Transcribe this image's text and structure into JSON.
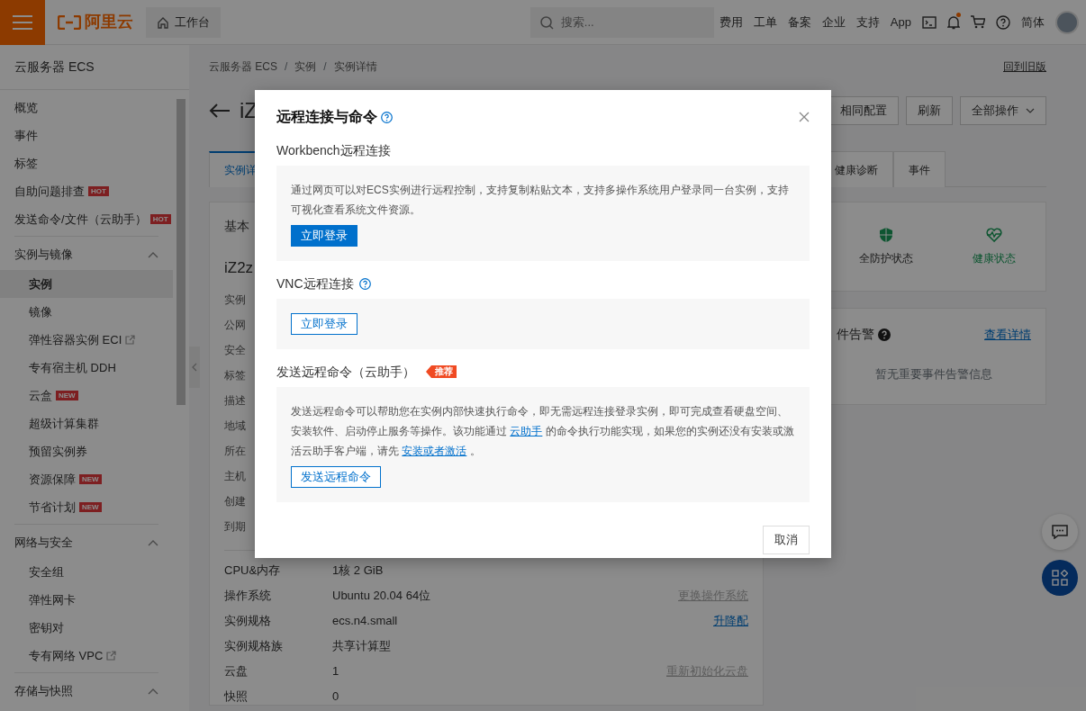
{
  "topbar": {
    "logo": "阿里云",
    "workbench": "工作台",
    "search": {
      "placeholder": "搜索..."
    },
    "links": [
      "费用",
      "工单",
      "备案",
      "企业",
      "支持",
      "App"
    ],
    "notification_dot": true,
    "language": "简体"
  },
  "sidebar": {
    "title": "云服务器 ECS",
    "items": [
      {
        "label": "概览",
        "selected": false
      },
      {
        "label": "事件",
        "selected": false
      },
      {
        "label": "标签",
        "selected": false
      },
      {
        "label": "自助问题排查",
        "badge": "HOT",
        "selected": false
      },
      {
        "label": "发送命令/文件（云助手）",
        "badge": "HOT",
        "selected": false
      }
    ],
    "groups": [
      {
        "label": "实例与镜像",
        "expanded": true,
        "items": [
          {
            "label": "实例",
            "selected": true,
            "external": false
          },
          {
            "label": "镜像",
            "selected": false,
            "external": false
          },
          {
            "label": "弹性容器实例 ECI",
            "selected": false,
            "external": true
          },
          {
            "label": "专有宿主机 DDH",
            "selected": false,
            "external": false
          },
          {
            "label": "云盒",
            "badge": "NEW",
            "selected": false,
            "external": false
          },
          {
            "label": "超级计算集群",
            "selected": false,
            "external": false
          },
          {
            "label": "预留实例券",
            "selected": false,
            "external": false
          },
          {
            "label": "资源保障",
            "badge": "NEW",
            "selected": false,
            "external": false
          },
          {
            "label": "节省计划",
            "badge": "NEW",
            "selected": false,
            "external": false
          }
        ]
      },
      {
        "label": "网络与安全",
        "expanded": true,
        "items": [
          {
            "label": "安全组",
            "selected": false,
            "external": false
          },
          {
            "label": "弹性网卡",
            "selected": false,
            "external": false
          },
          {
            "label": "密钥对",
            "selected": false,
            "external": false
          },
          {
            "label": "专有网络 VPC",
            "selected": false,
            "external": true
          }
        ]
      },
      {
        "label": "存储与快照",
        "expanded": true
      }
    ]
  },
  "main": {
    "breadcrumb": [
      "云服务器 ECS",
      "/",
      "实例",
      "/",
      "实例详情"
    ],
    "old_version": "回到旧版",
    "title": "iZ",
    "actions": [
      {
        "label": "相同配置",
        "dropdown": false
      },
      {
        "label": "刷新",
        "dropdown": false
      },
      {
        "label": "全部操作",
        "dropdown": true
      }
    ],
    "tabs": [
      {
        "label": "实例详",
        "selected": true
      },
      {
        "label": "健康诊断",
        "selected": false
      },
      {
        "label": "事件",
        "selected": false
      }
    ],
    "basic_info": {
      "heading": "基本",
      "name": "iZ2z",
      "labels": [
        "实例",
        "公网",
        "安全",
        "标签",
        "描述",
        "地域",
        "所在",
        "主机",
        "创建",
        "到期"
      ],
      "rows": [
        {
          "label": "CPU&内存",
          "value": "1核 2 GiB"
        },
        {
          "label": "操作系统",
          "value": "Ubuntu 20.04 64位",
          "action": "更换操作系统",
          "action_disabled": true
        },
        {
          "label": "实例规格",
          "value": "ecs.n4.small",
          "action": "升降配",
          "action_disabled": false
        },
        {
          "label": "实例规格族",
          "value": "共享计算型"
        },
        {
          "label": "云盘",
          "value": "1",
          "action": "重新初始化云盘",
          "action_disabled": true
        },
        {
          "label": "快照",
          "value": "0"
        }
      ]
    },
    "status": [
      {
        "label": "全防护状态",
        "kind": "shield"
      },
      {
        "label": "健康状态",
        "kind": "health"
      }
    ],
    "alerts": {
      "title": "件告警",
      "link": "查看详情",
      "empty": "暂无重要事件告警信息"
    }
  },
  "modal": {
    "title": "远程连接与命令",
    "sections": [
      {
        "title": "Workbench远程连接",
        "help": false,
        "description": [
          {
            "text": "通过网页可以对ECS实例进行远程控制，支持复制粘贴文本，支持多操作系统用户登录同一台实例，支持可视化查看系统文件资源。",
            "link": false
          }
        ],
        "button": {
          "label": "立即登录",
          "primary": true
        }
      },
      {
        "title": "VNC远程连接",
        "help": true,
        "button": {
          "label": "立即登录",
          "primary": false
        }
      },
      {
        "title": "发送远程命令（云助手）",
        "help": false,
        "tag": "推荐",
        "description": [
          {
            "text": "发送远程命令可以帮助您在实例内部快速执行命令，即无需远程连接登录实例，即可完成查看硬盘空间、安装软件、启动停止服务等操作。该功能通过 ",
            "link": false
          },
          {
            "text": "云助手",
            "link": true
          },
          {
            "text": " 的命令执行功能实现，如果您的实例还没有安装或激活云助手客户端，请先 ",
            "link": false
          },
          {
            "text": "安装或者激活",
            "link": true
          },
          {
            "text": " 。",
            "link": false
          }
        ],
        "button": {
          "label": "发送远程命令",
          "primary": false
        }
      }
    ],
    "cancel": "取消"
  }
}
